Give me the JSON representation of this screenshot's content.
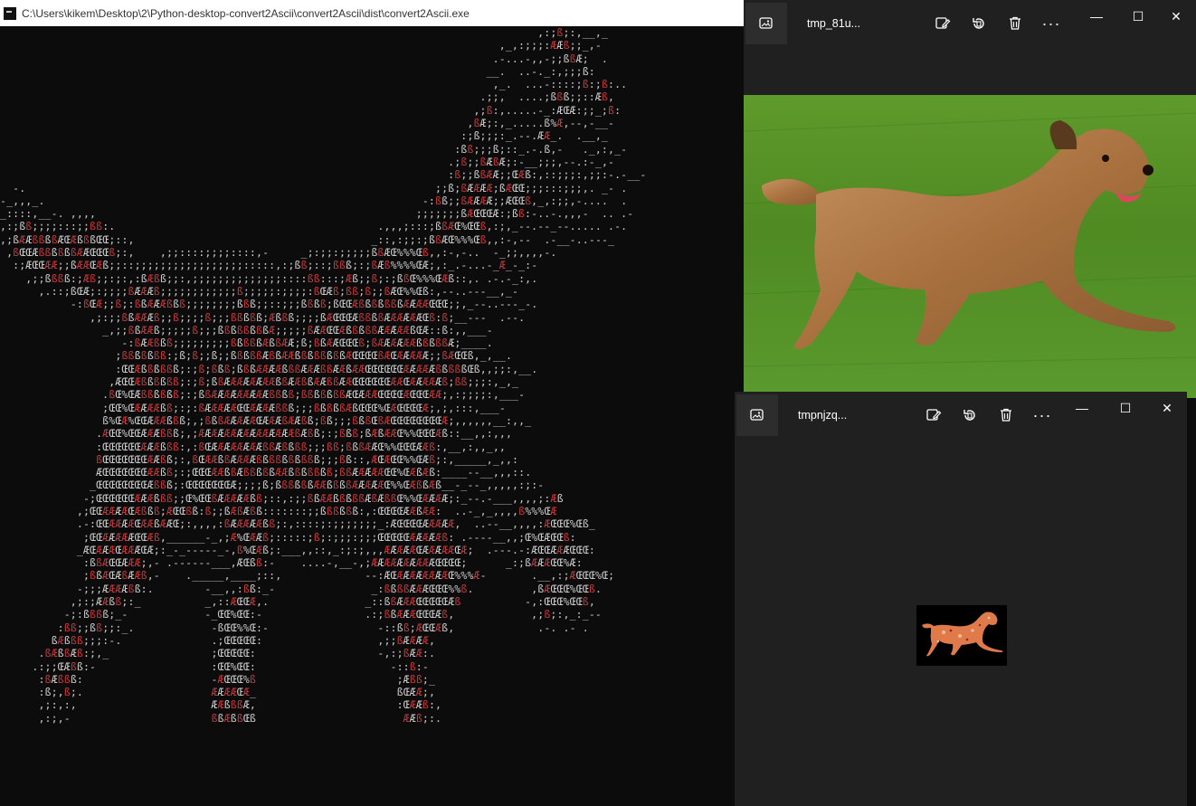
{
  "console": {
    "title": "C:\\Users\\kikem\\Desktop\\2\\Python-desktop-convert2Ascii\\convert2Ascii\\dist\\convert2Ascii.exe",
    "ascii_lines": [
      "                                                                                    ,:;ß;:,__,_",
      "                                                                              ,_,:;;;:ÆÆß;;_,-",
      "                                                                             .-...-,,-;;ßßÆ;  .",
      "                                                                            __.  ..-._:,;;;ß:",
      "                                                                             ,_.  ...-::::;ß:;ß:..",
      "                                                                           .;;,  ....;ßßß;;::Æß,",
      "                                                                          ,;ß:,.....-_:ÆŒÆ:;;_;ß:",
      "                                                                         ,ßÆ;:,_.....ß%Æ,--,-__-",
      "                                                                        :;ß;;;:_.--.ÆÆ_.  .__,_",
      "                                                                       :ßß;;;ß;::_.-.ß,-   ._,:,_-",
      "                                                                      .;ß;;ßÆßÆ;:-__;;;,--.:-_,-",
      "                                                                      :ß;;ßßÆÆ;;ŒÆß:,::;;;:,;;:-.-__-",
      "  -.                                                                ;;ß;ßÆÆÆÆ;ßÆŒŒ;;;:::;;;,. _- .",
      "-_,,,_.                                                           -:ßß;;ßÆÆÆÆ;;ÆŒŒß,_,:;;,-....  .",
      "_::::,__-. ,,,,                                                  ;;;;;;;ßÆŒŒŒÆ:;ßß:-..-.,,,-  .. .-",
      ",:;ßß;;;;:::;;ßß:.                                         .,,,;:::;ßßÆŒ%ŒŒß,:;,_--.--_--..... .-.",
      ",;ßÆÆßßßßÆŒÆßßßŒŒ;::,                                     _::,:;;:;ßßÆŒ%%%Œß,,:-,--  .-__-..---_",
      " ,ßŒŒÆßßßßßßÆÆŒŒŒß;:,    ,;;::::;;;;::::,-     _;:;;:;;;;;ßßÆŒ%%%Œß,,:-,-..  -_;;,,,,-.",
      "  :;ÆŒŒÆÆ;;ßÆÆŒÆß;;::;;;;;;;;;;;;;;;;;:::::,:;ßß;::;ßßß;:;ßÆß%%%%ŒÆ;,:_.-...-_Æ_-_:-",
      "    ,;;ßßßß:;Æß;;:;:,:ßÆßß;;:,;;;;;;;;;;;;;;::::ßß:::;Æß;;ß;:;ßßŒ%%%ŒÆß::,. .-.-_:,.",
      "      ,.::;ßŒÆ;:;;;;ßÆÆÆß;;;;;;;;;;;;ß;;;;;:;;;;:ßŒÆß;ßß;ß;;ßÆŒ%%Œß:,--..---__,_-",
      "           -:ßŒÆ;;ß;:ßßÆÆÆßßß;;;;;;;;ßßß;;::;;;ßßßß;ßŒŒÆßßßßßßßÆÆÆÆŒŒŒ;;,_--..---_-.",
      "              ,;:;;ßßÆÆÆß;;ß;;;;ß;;;ßßßßß;Æßßß;;;;ßÆŒŒŒÆßßßßÆÆÆÆÆÆŒß:ß;__---  .--.",
      "                _,;;ßßÆÆß;;;;;ß;;;ßßßßßßßßÆ;;;;;ßÆÆŒŒÆßßßßßÆÆÆÆÆßŒÆ::ß:,,___-",
      "                   -:ßÆÆßßß;;;;;;;;;ßßßßßÆßßÆÆ;ß;ßßÆÆŒŒŒß;ßÆÆÆÆÆÆßßßßßÆ;____.",
      "                  ;ßßßßßßß:;ß;ß;;ß;;ßßßßßÆßßÆÆßßßßßßßßÆŒŒŒŒßÆŒÆÆÆÆÆ;;ßÆŒŒß,_,__.",
      "                  :ŒŒÆßßßßßß;:;ß;ßßß;ßßßÆÆÆÆßßßÆÆÆßßÆÆßÆÆŒŒŒŒŒŒÆÆÆÆÆßßßßßŒß,,;;:,__.",
      "                 ,ÆŒŒÆßßßßßß;:;ß;ßßÆÆÆÆÆÆÆÆßßÆÆßßÆÆßßÆÆŒŒŒŒŒŒÆÆŒÆÆÆÆÆß;ßß;;;:,_,_",
      "                .ßŒ%ŒÆßßßßßß;:;ßßÆÆÆÆÆÆÆÆÆßßßß;ßßßßßßßÆŒÆÆÆŒŒŒŒÆŒŒŒÆÆ;,:;;;;:,___-",
      "                ;ŒŒ%ŒÆÆÆÆßß;:;:ßÆÆÆÆÆŒŒÆÆÆÆßßß;;;ßßßßßÆßŒŒŒ%ŒÆŒŒŒŒÆ;,;,:::,___-",
      "                ß%ŒÆ%ŒŒÆÆÆßßß;,;ßßßÆÆÆÆÆŒÆÆÆßÆÆßß;ßß;;;ßßßŒßÆŒŒŒŒŒŒŒŒÆ;,,,,,,__:,,_",
      "               .ÆŒŒ%ŒŒÆÆÆßßß;,;ÆÆÆÆÆÆÆÆÆÆÆÆÆÆÆßÆßß;:;ßßß;ßÆßÆÆŒ%%ŒŒŒÆß::__,,:,,,",
      "               :ŒŒŒŒŒŒÆÆÆßßß:,:ßŒÆÆÆÆÆÆÆÆßßÆßßßß;;;ßß;ßßßÆÆŒ%%ŒŒŒÆÆß:,__,:,,_,,",
      "               ßŒŒŒŒŒŒŒÆÆßß;:,ßŒÆÆßßÆÆÆÆßßßßßßßßßß;;;ßß::,ÆŒÆŒŒ%%ŒÆß;:,_____,_,,:",
      "               ÆŒŒŒŒŒŒŒÆÆßß;:;ŒŒŒÆÆßßÆßßßßßÆÆßßßßßßß;ßßÆÆÆÆÆŒŒ%ŒÆßÆß:____--__,,,::.",
      "              _ŒŒŒŒŒŒŒŒÆßßß;:ŒŒŒŒŒŒŒÆ;;;;ß;ßßßßßßÆÆßßßßÆÆÆÆÆŒ%%ŒÆßßÆß__-_--_,,,,,:;:-",
      "             -;ŒŒŒŒŒŒÆÆÆßßß;;Œ%ŒŒßÆÆÆÆÆßß;::,:;;ßßÆÆßßßßßÆßÆßßŒ%%ŒÆÆÆÆ;:_--.-___,,,,;:Æß",
      "            ,;ŒŒÆÆÆÆŒÆßßß;ÆŒŒßß:ß;;ßÆßÆßß:::::::;;ßßßßßß:,:ŒŒŒŒÆÆßÆÆ:  ..-_,_,,,,ß%%%ŒÆ",
      "            .-:ŒŒÆÆÆÆŒÆÆßÆÆŒ;:,,,,:ßÆÆÆÆÆßß;:,::::;:;;;;;;;_:ÆŒŒŒŒÆÆÆÆÆ,  ..--__,,,,:ÆŒŒŒ%Œß_",
      "             ;ŒŒÆÆÆÆÆŒŒÆß,______-_,;Æ%ŒÆÆß;:::::;ß;:;;;:;;;ŒŒŒŒŒÆÆÆÆÆß: .----__,,;Œ%ŒÆŒŒß:",
      "            _ÆŒÆÆÆŒÆÆÆŒÆ;:_-_-----_-,ß%ŒÆß;:___,,::,_:;:;,,,ÆÆÆÆÆŒÆÆÆÆÆŒÆ;  .---.-:ÆŒŒÆÆÆŒŒŒ:",
      "             :ßßÆŒŒÆÆÆ;,- .------___,ÆŒßß:-    ....-,__-,;ÆÆÆÆÆÆÆÆÆÆŒŒŒŒ;      _:;ßÆÆÆŒŒ%Æ:",
      "             ;ßßÆŒÆßÆÆß,-    ._____,____;::,             --:ÆŒÆÆÆÆÆÆÆÆŒ%%%Æ-       .__,:;ÆŒŒŒ%Œ;",
      "            -;;;ÆÆÆÆßß:.        -__,,:ßß:_-               _:ßßßßÆÆÆŒŒŒ%%ß.         ,ßÆŒŒŒ%ŒŒß.",
      "           ,;:;ÆÆßß;:_          _,::ÆŒŒÆ,.               _::ßßÆÆÆŒŒŒŒŒÆß          -,:ŒŒŒ%ŒŒß,",
      "          -;:ßßßß;_-            -_ŒŒ%ŒŒ:-                .:;ßßÆÆÆŒŒŒÆß,            ,;ß;:,_:_--",
      "         :ßß;;ßß;;:_.            -ßŒŒ%%Œ:-                 -::ßß;ÆŒŒÆß,             .-. .- .",
      "        ßÆßßß;;;:-.              .;ŒŒŒŒŒ:                  ,;;ßÆÆÆÆ,",
      "      .ßÆßßÆß:;,_                ;ŒŒŒŒŒ:                   -,:;ßÆÆ:.",
      "     .:;;ŒÆßß:-                  :ŒŒ%ŒŒ:                     -::ß:-",
      "      :ßÆßßß:                    -ÆŒŒŒ%ß                      ;Æßß;_",
      "      :ß;,ß;.                    ÆÆÆÆŒÆ_                      ßŒÆÆ;,",
      "      ,;:,:,                     ÆÆßßßÆ,                      :ŒÆÆß:,",
      "      ,:;,-                      ßßÆßßŒß                       ÆÆß;:."
    ]
  },
  "photos_top": {
    "filename": "tmp_81u...",
    "icons": [
      "photos-app-icon",
      "edit-icon",
      "rotate-icon",
      "delete-icon",
      "more-icon"
    ],
    "more_label": "···",
    "win_min": "—",
    "win_max": "☐",
    "win_close": "✕"
  },
  "photos_bottom": {
    "filename": "tmpnjzq...",
    "more_label": "···",
    "win_min": "—",
    "win_max": "☐",
    "win_close": "✕"
  },
  "colors": {
    "console_bg": "#0c0c0c",
    "ascii_light": "#cccccc",
    "ascii_red": "#c8383a",
    "photos_bg": "#202020",
    "grass": "#5a9a2e",
    "dog": "#b27c48"
  }
}
